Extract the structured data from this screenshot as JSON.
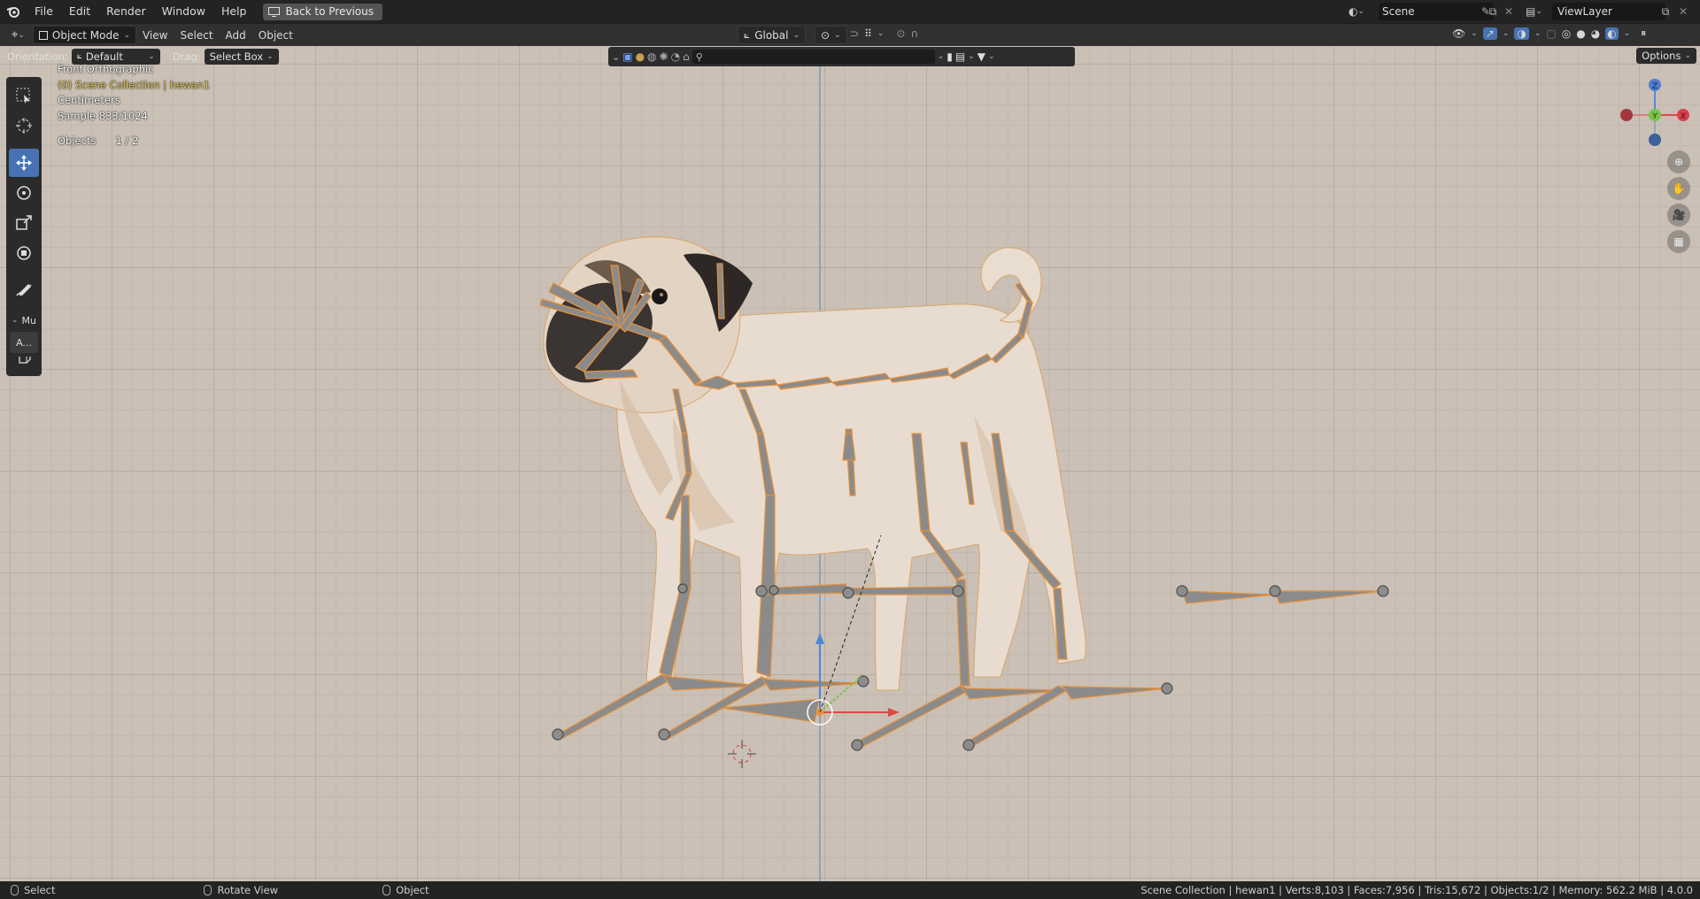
{
  "menu": {
    "file": "File",
    "edit": "Edit",
    "render": "Render",
    "window": "Window",
    "help": "Help",
    "back_button": "Back to Previous"
  },
  "scene": {
    "name": "Scene"
  },
  "view_layer": {
    "name": "ViewLayer"
  },
  "header": {
    "mode": "Object Mode",
    "view": "View",
    "select": "Select",
    "add": "Add",
    "object": "Object",
    "transform_orientation": "Global"
  },
  "tool_settings": {
    "orientation_label": "Orientation:",
    "orientation_value": "Default",
    "drag_label": "Drag:",
    "drag_value": "Select Box",
    "options": "Options"
  },
  "overlay": {
    "view_name": "Front Orthographic",
    "collection": "(0) Scene Collection | hewan1",
    "units": "Centimeters",
    "sample": "Sample 833/1024",
    "objects_label": "Objects",
    "objects_value": "1 / 2"
  },
  "tool_panel": {
    "collapse_label": "Mu",
    "item_label": "A..."
  },
  "gizmo": {
    "z": "Z",
    "y": "Y",
    "x": "X"
  },
  "status": {
    "select": "Select",
    "rotate_view": "Rotate View",
    "object": "Object",
    "stats": "Scene Collection | hewan1 | Verts:8,103 | Faces:7,956 | Tris:15,672 | Objects:1/2 | Memory: 562.2 MiB | 4.0.0"
  },
  "colors": {
    "viewport_bg": "#cac0b5",
    "active_tool": "#4772b3",
    "selection_outline": "#e8903a",
    "bone_fill": "#8c8c8c"
  },
  "icons": [
    "blender-logo",
    "select-box-icon",
    "cursor-icon",
    "move-icon",
    "rotate-icon",
    "scale-icon",
    "transform-icon",
    "annotate-icon",
    "measure-icon",
    "add-cube-icon",
    "search-icon",
    "filter-icon",
    "eye-icon",
    "gizmo-icon",
    "overlay-icon",
    "shading-solid-icon",
    "zoom-icon",
    "hand-pan-icon",
    "camera-icon",
    "grid-icon"
  ]
}
